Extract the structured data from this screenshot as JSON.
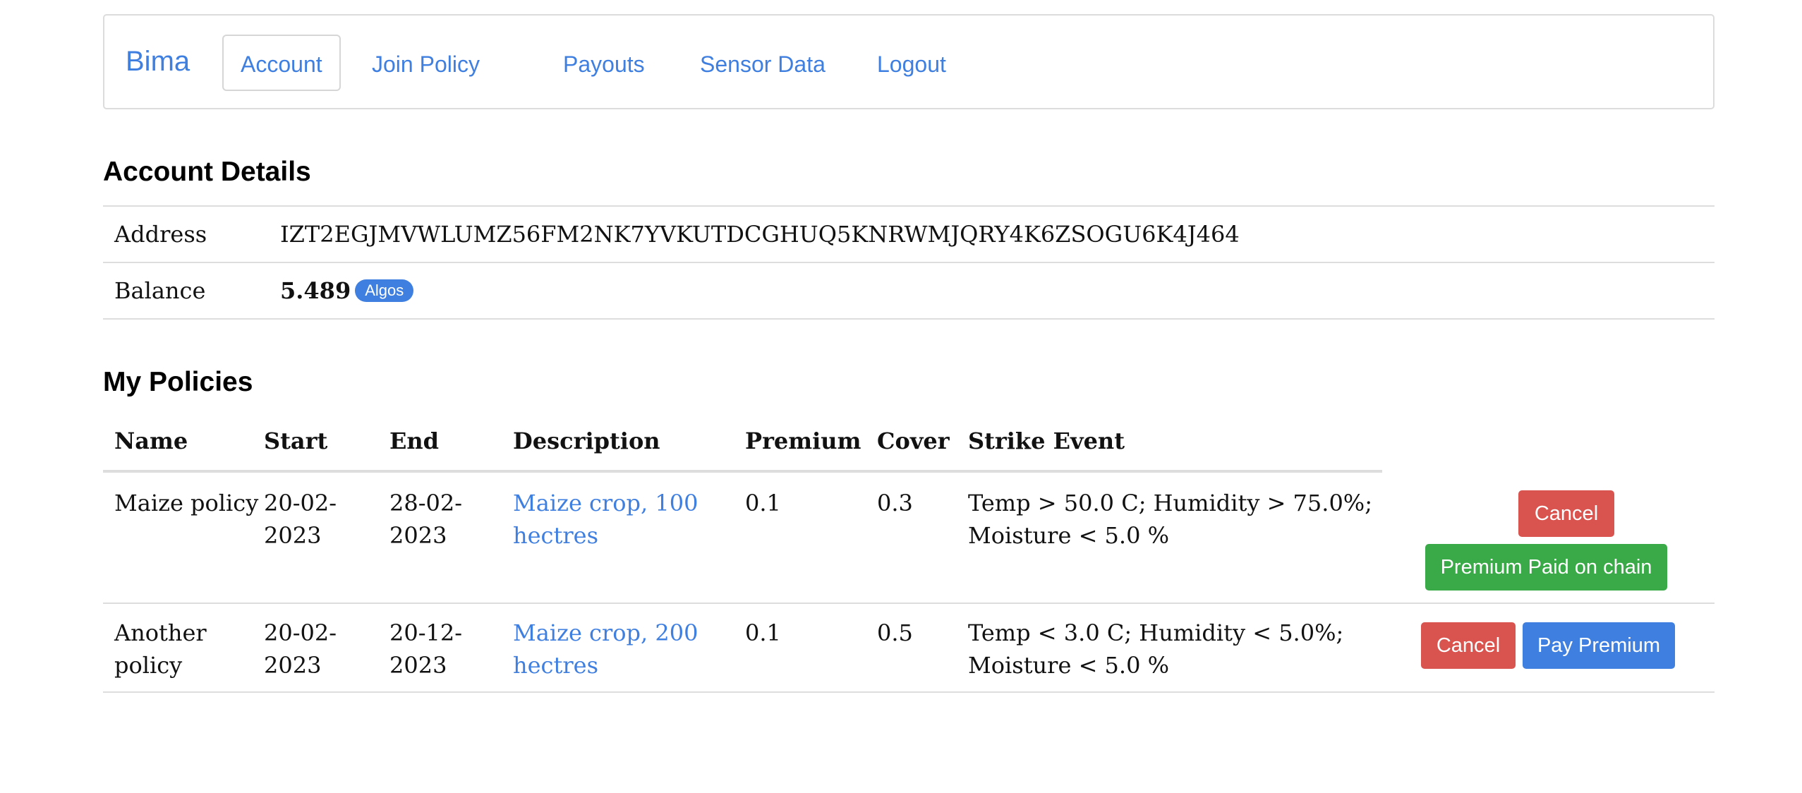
{
  "navbar": {
    "brand": "Bima",
    "items": [
      {
        "label": "Account",
        "active": true
      },
      {
        "label": "Join Policy",
        "active": false
      },
      {
        "label": "Payouts",
        "active": false
      },
      {
        "label": "Sensor Data",
        "active": false
      },
      {
        "label": "Logout",
        "active": false
      }
    ]
  },
  "account": {
    "title": "Account Details",
    "address_label": "Address",
    "address_value": "IZT2EGJMVWLUMZ56FM2NK7YVKUTDCGHUQ5KNRWMJQRY4K6ZSOGU6K4J464",
    "balance_label": "Balance",
    "balance_value": "5.489",
    "balance_unit": "Algos"
  },
  "policies": {
    "title": "My Policies",
    "columns": [
      "Name",
      "Start",
      "End",
      "Description",
      "Premium",
      "Cover",
      "Strike Event"
    ],
    "rows": [
      {
        "name_line1": "Maize policy",
        "name_line2": "",
        "start_line1": "20-02-",
        "start_line2": "2023",
        "end_line1": "28-02-",
        "end_line2": "2023",
        "desc_line1": "Maize crop, 100",
        "desc_line2": "hectres",
        "premium": "0.1",
        "cover": "0.3",
        "strike_line1": "Temp > 50.0 C; Humidity > 75.0%;",
        "strike_line2": "Moisture < 5.0 %",
        "cancel_label": "Cancel",
        "status_label": "Premium Paid on chain"
      },
      {
        "name_line1": "Another",
        "name_line2": "policy",
        "start_line1": "20-02-",
        "start_line2": "2023",
        "end_line1": "20-12-",
        "end_line2": "2023",
        "desc_line1": "Maize crop, 200",
        "desc_line2": "hectres",
        "premium": "0.1",
        "cover": "0.5",
        "strike_line1": "Temp < 3.0 C; Humidity < 5.0%;",
        "strike_line2": "Moisture < 5.0 %",
        "cancel_label": "Cancel",
        "pay_label": "Pay Premium"
      }
    ]
  },
  "colors": {
    "link": "#3f7fe0",
    "danger": "#d9534f",
    "success": "#3aaa48",
    "primary": "#3f7fe0"
  }
}
